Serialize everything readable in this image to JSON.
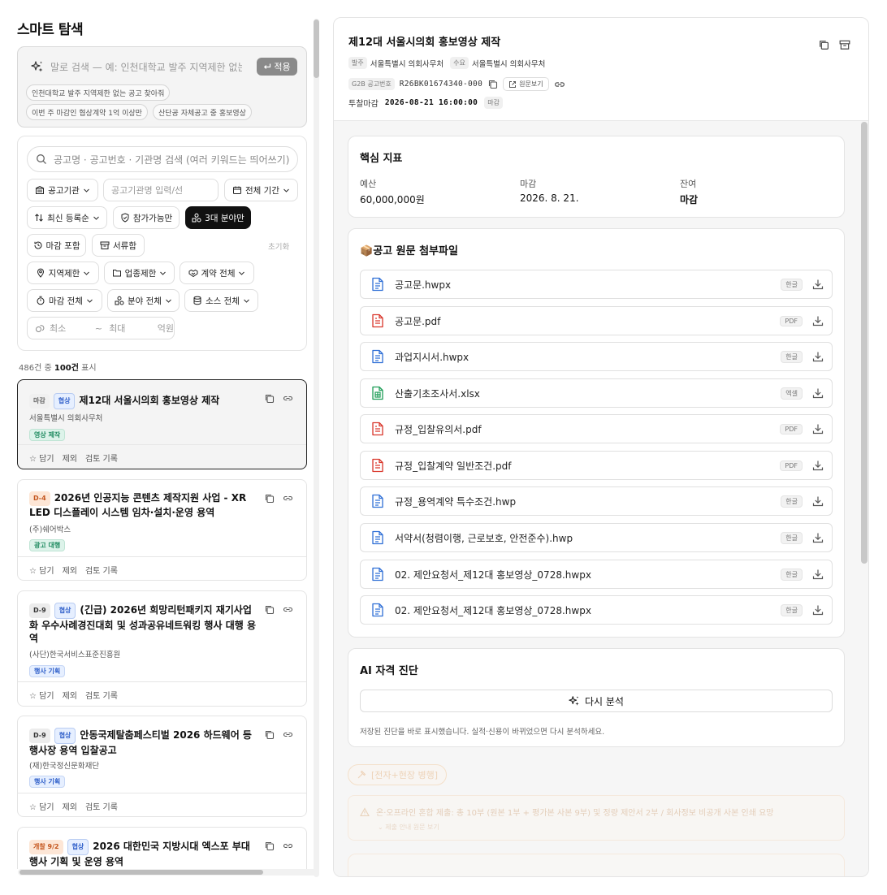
{
  "left": {
    "title": "스마트 탐색",
    "nl_search": {
      "placeholder": "말로 검색 — 예: 인천대학교 발주 지역제한 없는",
      "apply_label": "적용",
      "suggestions": [
        "인천대학교 발주 지역제한 없는 공고 찾아줘",
        "이번 주 마감인 협상계약 1억 이상만",
        "산단공 자체공고 중 홍보영상"
      ]
    },
    "filters": {
      "search_placeholder": "공고명 · 공고번호 · 기관명 검색 (여러 키워드는 띄어쓰기)",
      "agency_select": "공고기관",
      "agency_input_placeholder": "공고기관명 입력/선",
      "period": "전체 기간",
      "sort": "최신 등록순",
      "eligible": "참가가능만",
      "top3": "3대 분야만",
      "include_closed": "마감 포함",
      "doc_type": "서류함",
      "reset": "초기화",
      "region": "지역제한",
      "industry": "업종제한",
      "contract": "계약 전체",
      "deadline": "마감 전체",
      "field": "분야 전체",
      "source": "소스 전체",
      "min_placeholder": "최소",
      "tilde": "~",
      "max_placeholder": "최대",
      "unit": "억원"
    },
    "count": {
      "total": "486건 중",
      "shown": "100건",
      "suffix": "표시"
    },
    "card_actions": [
      "담기",
      "제외",
      "검토 기록"
    ],
    "cards": [
      {
        "status": "마감",
        "method": "협상",
        "title": "제12대 서울시의회 홍보영상 제작",
        "org": "서울특별시 의회사무처",
        "category": "영상 제작"
      },
      {
        "status": "D-4",
        "title": "2026년 인공지능 콘텐츠 제작지원 사업 - XR LED 디스플레이 시스템 임차·설치·운영 용역",
        "org": "(주)쉐어박스",
        "category": "광고 대행"
      },
      {
        "status": "D-9",
        "method": "협상",
        "title": "(긴급) 2026년 희망리턴패키지 재기사업화 우수사례경진대회 및 성과공유네트워킹 행사 대행 용역",
        "org": "(사단)한국서비스표준진흥원",
        "category": "행사 기획"
      },
      {
        "status": "D-9",
        "method": "협상",
        "title": "안동국제탈춤페스티벌 2026 하드웨어 등 행사장 용역 입찰공고",
        "org": "(재)한국정신문화재단",
        "category": "행사 기획"
      },
      {
        "status": "개찰 9/2",
        "method": "협상",
        "title": "2026 대한민국 지방시대 엑스포 부대행사 기획 및 운영 용역"
      }
    ]
  },
  "detail": {
    "title": "제12대 서울시의회 홍보영상 제작",
    "order_label": "발주",
    "order_org": "서울특별시 의회사무처",
    "demand_label": "수요",
    "demand_org": "서울특별시 의회사무처",
    "g2b_label": "G2B 공고번호",
    "notice_no": "R26BK01674340-000",
    "original_label": "원문보기",
    "deadline_label": "투찰마감",
    "deadline": "2026-08-21 16:00:00",
    "deadline_badge": "마감",
    "kpi_title": "핵심 지표",
    "kpis": [
      {
        "label": "예산",
        "value": "60,000,000원"
      },
      {
        "label": "마감",
        "value": "2026. 8. 21."
      },
      {
        "label": "잔여",
        "value": "마감"
      }
    ],
    "files_title": "공고 원문 첨부파일",
    "files_emoji": "📦",
    "files": [
      {
        "name": "공고문.hwpx",
        "badge": "한글"
      },
      {
        "name": "공고문.pdf",
        "badge": "PDF"
      },
      {
        "name": "과업지시서.hwpx",
        "badge": "한글"
      },
      {
        "name": "산출기초조사서.xlsx",
        "badge": "엑셀"
      },
      {
        "name": "규정_입찰유의서.pdf",
        "badge": "PDF"
      },
      {
        "name": "규정_입찰계약 일반조건.pdf",
        "badge": "PDF"
      },
      {
        "name": "규정_용역계약 특수조건.hwp",
        "badge": "한글"
      },
      {
        "name": "서약서(청렴이행, 근로보호, 안전준수).hwp",
        "badge": "한글"
      },
      {
        "name": "02. 제안요청서_제12대 홍보영상_0728.hwpx",
        "badge": "한글"
      },
      {
        "name": "02. 제안요청서_제12대 홍보영상_0728.hwpx",
        "badge": "한글"
      }
    ],
    "ai_title": "AI 자격 진단",
    "reanalyze": "다시 분석",
    "ai_note": "저장된 진단을 바로 표시했습니다. 실적·신용이 바뀌었으면 다시 분석하세요.",
    "submit_badge": "[전자+현장 병행]",
    "warning": "온·오프라인 혼합 제출: 총 10부 (원본 1부 + 평가본 사본 9부) 및 정량 제안서 2부 / 회사정보 비공개 사본 인쇄 요망",
    "warning_toggle": "제출 안내 원문 보기"
  },
  "colors": {
    "accent": "#111111",
    "hwp_blue": "#2f6fd6",
    "pdf_red": "#d9362b",
    "xlsx_green": "#1f9d57"
  }
}
